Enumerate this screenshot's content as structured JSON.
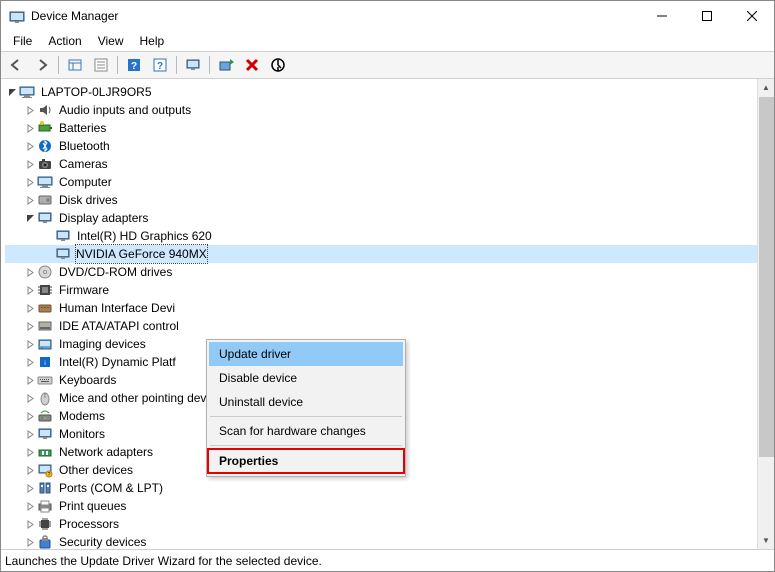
{
  "window": {
    "title": "Device Manager"
  },
  "menubar": {
    "file": "File",
    "action": "Action",
    "view": "View",
    "help": "Help"
  },
  "tree": {
    "root": "LAPTOP-0LJR9OR5",
    "display_adapters": "Display adapters",
    "adapters": [
      "Intel(R) HD Graphics 620",
      "NVIDIA GeForce 940MX"
    ],
    "categories": [
      "Audio inputs and outputs",
      "Batteries",
      "Bluetooth",
      "Cameras",
      "Computer",
      "Disk drives",
      "DVD/CD-ROM drives",
      "Firmware",
      "Human Interface Devi",
      "IDE ATA/ATAPI control",
      "Imaging devices",
      "Intel(R) Dynamic Platf",
      "Keyboards",
      "Mice and other pointing devices",
      "Modems",
      "Monitors",
      "Network adapters",
      "Other devices",
      "Ports (COM & LPT)",
      "Print queues",
      "Processors",
      "Security devices"
    ]
  },
  "context_menu": {
    "update": "Update driver",
    "disable": "Disable device",
    "uninstall": "Uninstall device",
    "scan": "Scan for hardware changes",
    "properties": "Properties"
  },
  "statusbar": {
    "text": "Launches the Update Driver Wizard for the selected device."
  }
}
